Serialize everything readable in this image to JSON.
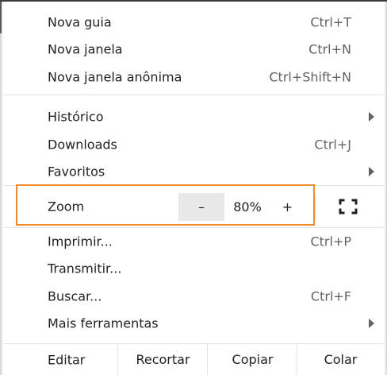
{
  "menu": {
    "new_tab": {
      "label": "Nova guia",
      "shortcut": "Ctrl+T"
    },
    "new_window": {
      "label": "Nova janela",
      "shortcut": "Ctrl+N"
    },
    "new_incognito": {
      "label": "Nova janela anônima",
      "shortcut": "Ctrl+Shift+N"
    },
    "history": {
      "label": "Histórico"
    },
    "downloads": {
      "label": "Downloads",
      "shortcut": "Ctrl+J"
    },
    "bookmarks": {
      "label": "Favoritos"
    },
    "zoom": {
      "label": "Zoom",
      "minus": "–",
      "value": "80%",
      "plus": "+"
    },
    "print": {
      "label": "Imprimir...",
      "shortcut": "Ctrl+P"
    },
    "cast": {
      "label": "Transmitir..."
    },
    "find": {
      "label": "Buscar...",
      "shortcut": "Ctrl+F"
    },
    "more_tools": {
      "label": "Mais ferramentas"
    },
    "edit": {
      "label": "Editar",
      "cut": "Recortar",
      "copy": "Copiar",
      "paste": "Colar"
    }
  },
  "colors": {
    "highlight": "#ef8b2c",
    "zoom_minus_bg": "#e8e8e8",
    "text": "#202124",
    "shortcut": "#5f6368"
  }
}
